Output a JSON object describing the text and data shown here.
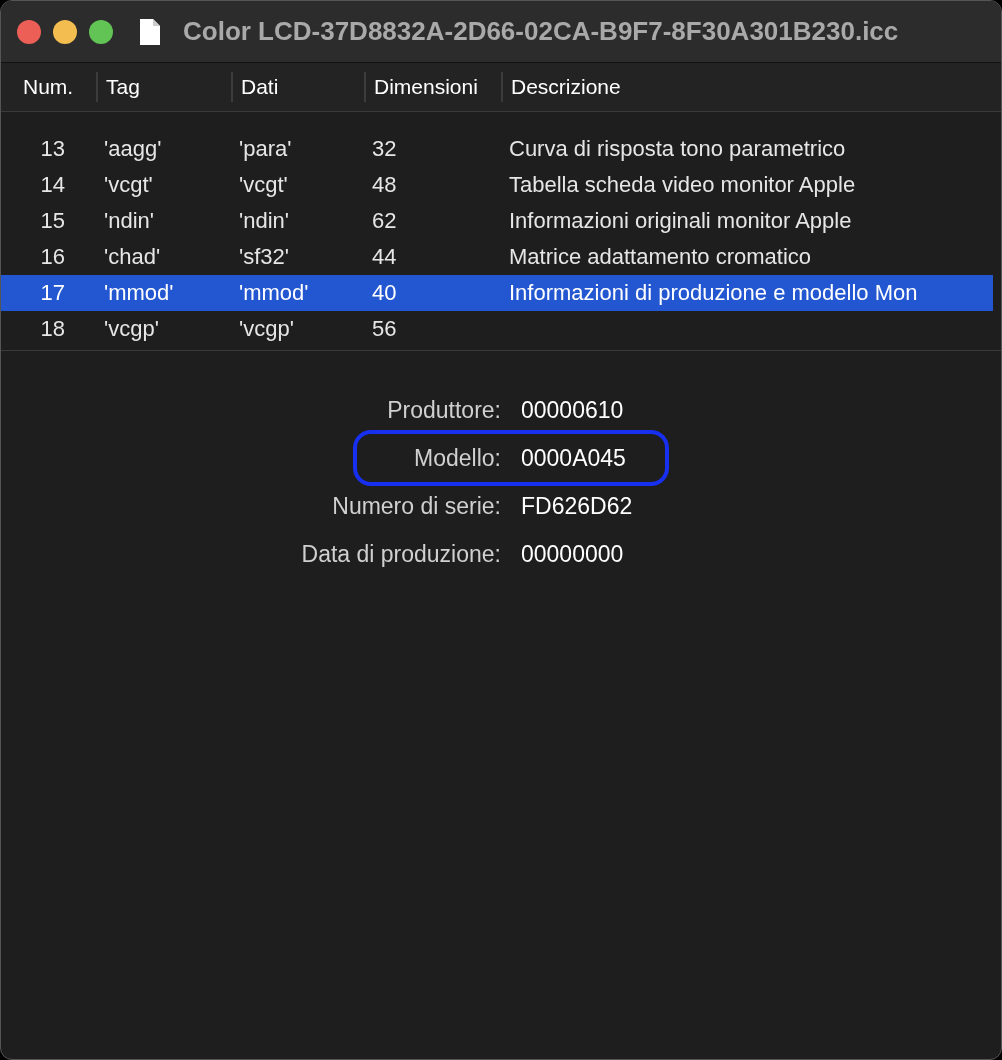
{
  "window": {
    "title": "Color LCD-37D8832A-2D66-02CA-B9F7-8F30A301B230.icc"
  },
  "table": {
    "columns": [
      "Num.",
      "Tag",
      "Dati",
      "Dimensioni",
      "Descrizione"
    ],
    "rows": [
      {
        "cells": [
          "13",
          "'aagg'",
          "'para'",
          "32",
          "Curva di risposta tono parametrico"
        ],
        "selected": false
      },
      {
        "cells": [
          "14",
          "'vcgt'",
          "'vcgt'",
          "48",
          "Tabella scheda video monitor Apple"
        ],
        "selected": false
      },
      {
        "cells": [
          "15",
          "'ndin'",
          "'ndin'",
          "62",
          "Informazioni originali monitor Apple"
        ],
        "selected": false
      },
      {
        "cells": [
          "16",
          "'chad'",
          "'sf32'",
          "44",
          "Matrice adattamento cromatico"
        ],
        "selected": false
      },
      {
        "cells": [
          "17",
          "'mmod'",
          "'mmod'",
          "40",
          "Informazioni di produzione e modello Mon"
        ],
        "selected": true
      },
      {
        "cells": [
          "18",
          "'vcgp'",
          "'vcgp'",
          "56",
          ""
        ],
        "selected": false
      }
    ]
  },
  "details": [
    {
      "label": "Produttore:",
      "value": "00000610",
      "highlighted": false
    },
    {
      "label": "Modello:",
      "value": "0000A045",
      "highlighted": true
    },
    {
      "label": "Numero di serie:",
      "value": "FD626D62",
      "highlighted": false
    },
    {
      "label": "Data di produzione:",
      "value": "00000000",
      "highlighted": false
    }
  ]
}
